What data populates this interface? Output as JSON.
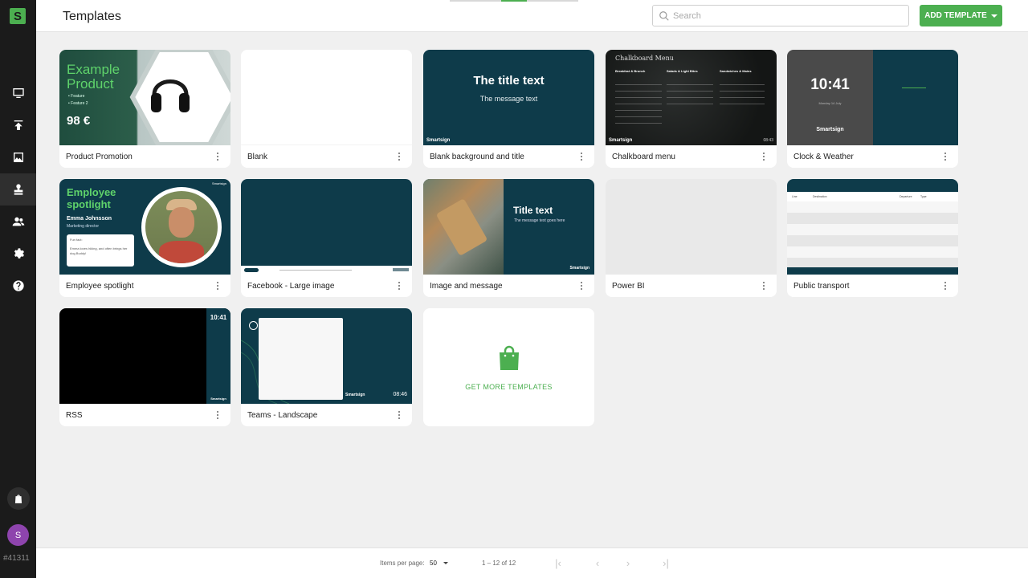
{
  "app": {
    "logo_letter": "S",
    "account_id": "#41311",
    "avatar_initial": "S"
  },
  "header": {
    "title": "Templates",
    "search_placeholder": "Search",
    "add_button": "ADD TEMPLATE"
  },
  "sidebar": {
    "items": [
      {
        "name": "screens",
        "icon": "monitor-icon"
      },
      {
        "name": "publish",
        "icon": "upload-icon"
      },
      {
        "name": "media",
        "icon": "image-icon"
      },
      {
        "name": "templates",
        "icon": "stamp-icon",
        "active": true
      },
      {
        "name": "users",
        "icon": "users-icon"
      },
      {
        "name": "settings",
        "icon": "gear-icon"
      },
      {
        "name": "help",
        "icon": "help-icon"
      }
    ]
  },
  "templates": [
    {
      "label": "Product Promotion",
      "thumb": {
        "title_line1": "Example",
        "title_line2": "Product",
        "bullet1": "• Feature",
        "bullet2": "• Feature 2",
        "price": "98 €"
      }
    },
    {
      "label": "Blank"
    },
    {
      "label": "Blank background and title",
      "thumb": {
        "title": "The title text",
        "message": "The message text",
        "brand": "Smartsign"
      }
    },
    {
      "label": "Chalkboard menu",
      "thumb": {
        "heading": "Chalkboard Menu",
        "col1": "Breakfast & Brunch",
        "col2": "Salads & Light Bites",
        "col3": "Sandwiches & Mains",
        "time": "08:43",
        "brand": "Smartsign"
      }
    },
    {
      "label": "Clock & Weather",
      "thumb": {
        "time": "10:41",
        "date": "Monday 14 July",
        "brand": "Smartsign"
      }
    },
    {
      "label": "Employee spotlight",
      "thumb": {
        "title_line1": "Employee",
        "title_line2": "spotlight",
        "name": "Emma Johnsson",
        "role": "Marketing director",
        "fun_fact_label": "Fun fact:",
        "fun_fact": "Emma loves hiking, and often brings her dog Buddy!",
        "brand": "Smartsign"
      }
    },
    {
      "label": "Facebook - Large image"
    },
    {
      "label": "Image and message",
      "thumb": {
        "title": "Title text",
        "message": "The message text goes here",
        "brand": "Smartsign"
      }
    },
    {
      "label": "Power BI"
    },
    {
      "label": "Public transport",
      "thumb": {
        "col_line": "Line",
        "col_destination": "Destination",
        "col_departure": "Departure",
        "col_type": "Type"
      }
    },
    {
      "label": "RSS",
      "thumb": {
        "time": "10:41",
        "brand": "Smartsign"
      }
    },
    {
      "label": "Teams - Landscape",
      "thumb": {
        "time": "08:46",
        "brand": "Smartsign"
      }
    }
  ],
  "get_more": {
    "label": "GET MORE TEMPLATES"
  },
  "footer": {
    "items_per_page_label": "Items per page:",
    "items_per_page_value": "50",
    "range": "1 – 12 of 12"
  },
  "colors": {
    "accent": "#4caf50",
    "sidebar": "#1b1b1b",
    "thumb_dark": "#0e3b4a"
  }
}
